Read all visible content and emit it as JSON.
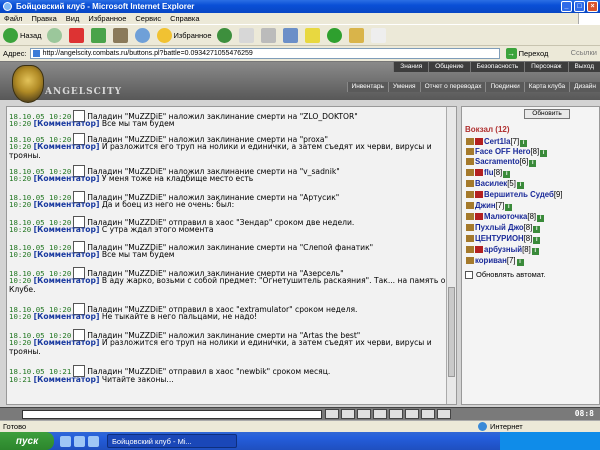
{
  "window": {
    "title": "Бойцовский клуб - Microsoft Internet Explorer",
    "min_label": "_",
    "max_label": "□",
    "close_label": "×"
  },
  "menu": {
    "items": [
      "Файл",
      "Правка",
      "Вид",
      "Избранное",
      "Сервис",
      "Справка"
    ]
  },
  "toolbar": {
    "back_label": "Назад",
    "favorites_label": "Избранное"
  },
  "address": {
    "label": "Адрес:",
    "url": "http://angelscity.combats.ru/buttons.pl?battle=0.0934271055476259",
    "go_label": "Переход",
    "links_label": "Ссылки"
  },
  "site": {
    "city_name": "ANGELSCITY",
    "top_nav": [
      "Знания",
      "Общение",
      "Безопасность",
      "Персонаж",
      "Выход"
    ],
    "sub_nav": [
      "Инвентарь",
      "Умения",
      "Отчет о переводах",
      "Поединки",
      "Карта клуба",
      "Дизайн"
    ]
  },
  "chat": {
    "messages": [
      {
        "time": "18.10.05 10:20",
        "text": "Паладин \"MuZZDiE\" наложил заклинание смерти на \"ZLO_DOKTOR\""
      },
      {
        "time": "10:20",
        "who": "[Комментатор]",
        "text": "Все мы там будем"
      },
      {
        "time": "18.10.05 10:20",
        "text": "Паладин \"MuZZDiE\" наложил заклинание смерти на \"proxa\""
      },
      {
        "time": "10:20",
        "who": "[Комментатор]",
        "text": "И разложится его труп на нолики и единички, а затем съедят их черви, вирусы и трояны."
      },
      {
        "time": "18.10.05 10:20",
        "text": "Паладин \"MuZZDiE\" наложил заклинание смерти на \"v_sadnik\""
      },
      {
        "time": "10:20",
        "who": "[Комментатор]",
        "text": "У меня тоже на кладбище место есть"
      },
      {
        "time": "18.10.05 10:20",
        "text": "Паладин \"MuZZDiE\" наложил заклинание смерти на \"Артусик\""
      },
      {
        "time": "10:20",
        "who": "[Комментатор]",
        "text": "Да и боец из него не очень: был:"
      },
      {
        "time": "18.10.05 10:20",
        "text": "Паладин \"MuZZDiE\" отправил в хаос \"Зендар\" сроком две недели."
      },
      {
        "time": "10:20",
        "who": "[Комментатор]",
        "text": "С утра ждал этого момента"
      },
      {
        "time": "18.10.05 10:20",
        "text": "Паладин \"MuZZDiE\" наложил заклинание смерти на \"Слепой фанатик\""
      },
      {
        "time": "10:20",
        "who": "[Комментатор]",
        "text": "Все мы там будем"
      },
      {
        "time": "18.10.05 10:20",
        "text": "Паладин \"MuZZDiE\" наложил заклинание смерти на \"Азерсель\""
      },
      {
        "time": "10:20",
        "who": "[Комментатор]",
        "text": "В аду жарко, возьми с собой предмет: \"Огнетушитель раскаяния\". Так... на память о Клубе."
      },
      {
        "time": "18.10.05 10:20",
        "text": "Паладин \"MuZZDiE\" отправил в хаос \"extramulator\" сроком неделя."
      },
      {
        "time": "10:20",
        "who": "[Комментатор]",
        "text": "Не тыкайте в него пальцами, не надо!"
      },
      {
        "time": "18.10.05 10:20",
        "text": "Паладин \"MuZZDiE\" наложил заклинание смерти на \"Artas the best\""
      },
      {
        "time": "10:20",
        "who": "[Комментатор]",
        "text": "И разложится его труп на нолики и единички, а затем съедят их черви, вирусы и трояны."
      },
      {
        "time": "18.10.05 10:21",
        "text": "Паладин \"MuZZDiE\" отправил в хаос \"newbik\" сроком месяц."
      },
      {
        "time": "10:21",
        "who": "[Комментатор]",
        "text": "Читайте законы..."
      }
    ]
  },
  "panel": {
    "refresh_label": "Обновить",
    "location": "Вокзал (12)",
    "users": [
      {
        "name": "Cert1la",
        "level": "[7]"
      },
      {
        "name": "Face OFF Hero",
        "level": "[8]"
      },
      {
        "name": "Sacramento",
        "level": "[6]"
      },
      {
        "name": "flu",
        "level": "[8]"
      },
      {
        "name": "Василек",
        "level": "[5]"
      },
      {
        "name": "Вершитель Судеб",
        "level": "[9]"
      },
      {
        "name": "Джин",
        "level": "[7]"
      },
      {
        "name": "Малюточка",
        "level": "[8]"
      },
      {
        "name": "Пухлый Джо",
        "level": "[8]"
      },
      {
        "name": "ЦЕНТУРИОН",
        "level": "[8]"
      },
      {
        "name": "арбузный",
        "level": "[8]"
      },
      {
        "name": "кориван",
        "level": "[7]"
      }
    ],
    "auto_refresh_label": "Обновлять автомат."
  },
  "inputbar": {
    "clock": "08:8"
  },
  "status": {
    "left": "Готово",
    "zone": "Интернет"
  },
  "taskbar": {
    "start_label": "пуск",
    "task_label": "Бойцовский клуб - Mi..."
  }
}
